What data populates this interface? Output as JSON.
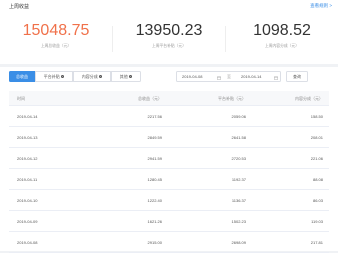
{
  "summary": {
    "title": "上周收益",
    "rules_link": "查看规则 >",
    "stats": [
      {
        "value": "15048.75",
        "label": "上周总收益（元）"
      },
      {
        "value": "13950.23",
        "label": "上周平台补贴（元）"
      },
      {
        "value": "1098.52",
        "label": "上周内容分成（元）"
      }
    ]
  },
  "tabs": [
    {
      "label": "总收益"
    },
    {
      "label": "平台补贴"
    },
    {
      "label": "内容分成"
    },
    {
      "label": "其他"
    }
  ],
  "date_range": {
    "start": "2019-04-08",
    "separator": "至",
    "end": "2019-04-14"
  },
  "query_button": "查询",
  "table": {
    "headers": [
      "时间",
      "总收益（元）",
      "平台补贴（元）",
      "内容分成（元）"
    ],
    "rows": [
      [
        "2019-04-14",
        "2217.56",
        "2059.06",
        "158.50"
      ],
      [
        "2019-04-13",
        "2849.59",
        "2641.58",
        "208.01"
      ],
      [
        "2019-04-12",
        "2941.59",
        "2720.53",
        "221.06"
      ],
      [
        "2019-04-11",
        "1280.45",
        "1192.37",
        "88.08"
      ],
      [
        "2019-04-10",
        "1222.40",
        "1136.37",
        "86.03"
      ],
      [
        "2019-04-09",
        "1621.26",
        "1502.23",
        "119.03"
      ],
      [
        "2019-04-08",
        "2915.00",
        "2698.09",
        "217.81"
      ]
    ]
  },
  "colors": {
    "accent": "#3a8ee6",
    "highlight_value": "#f0714a"
  }
}
